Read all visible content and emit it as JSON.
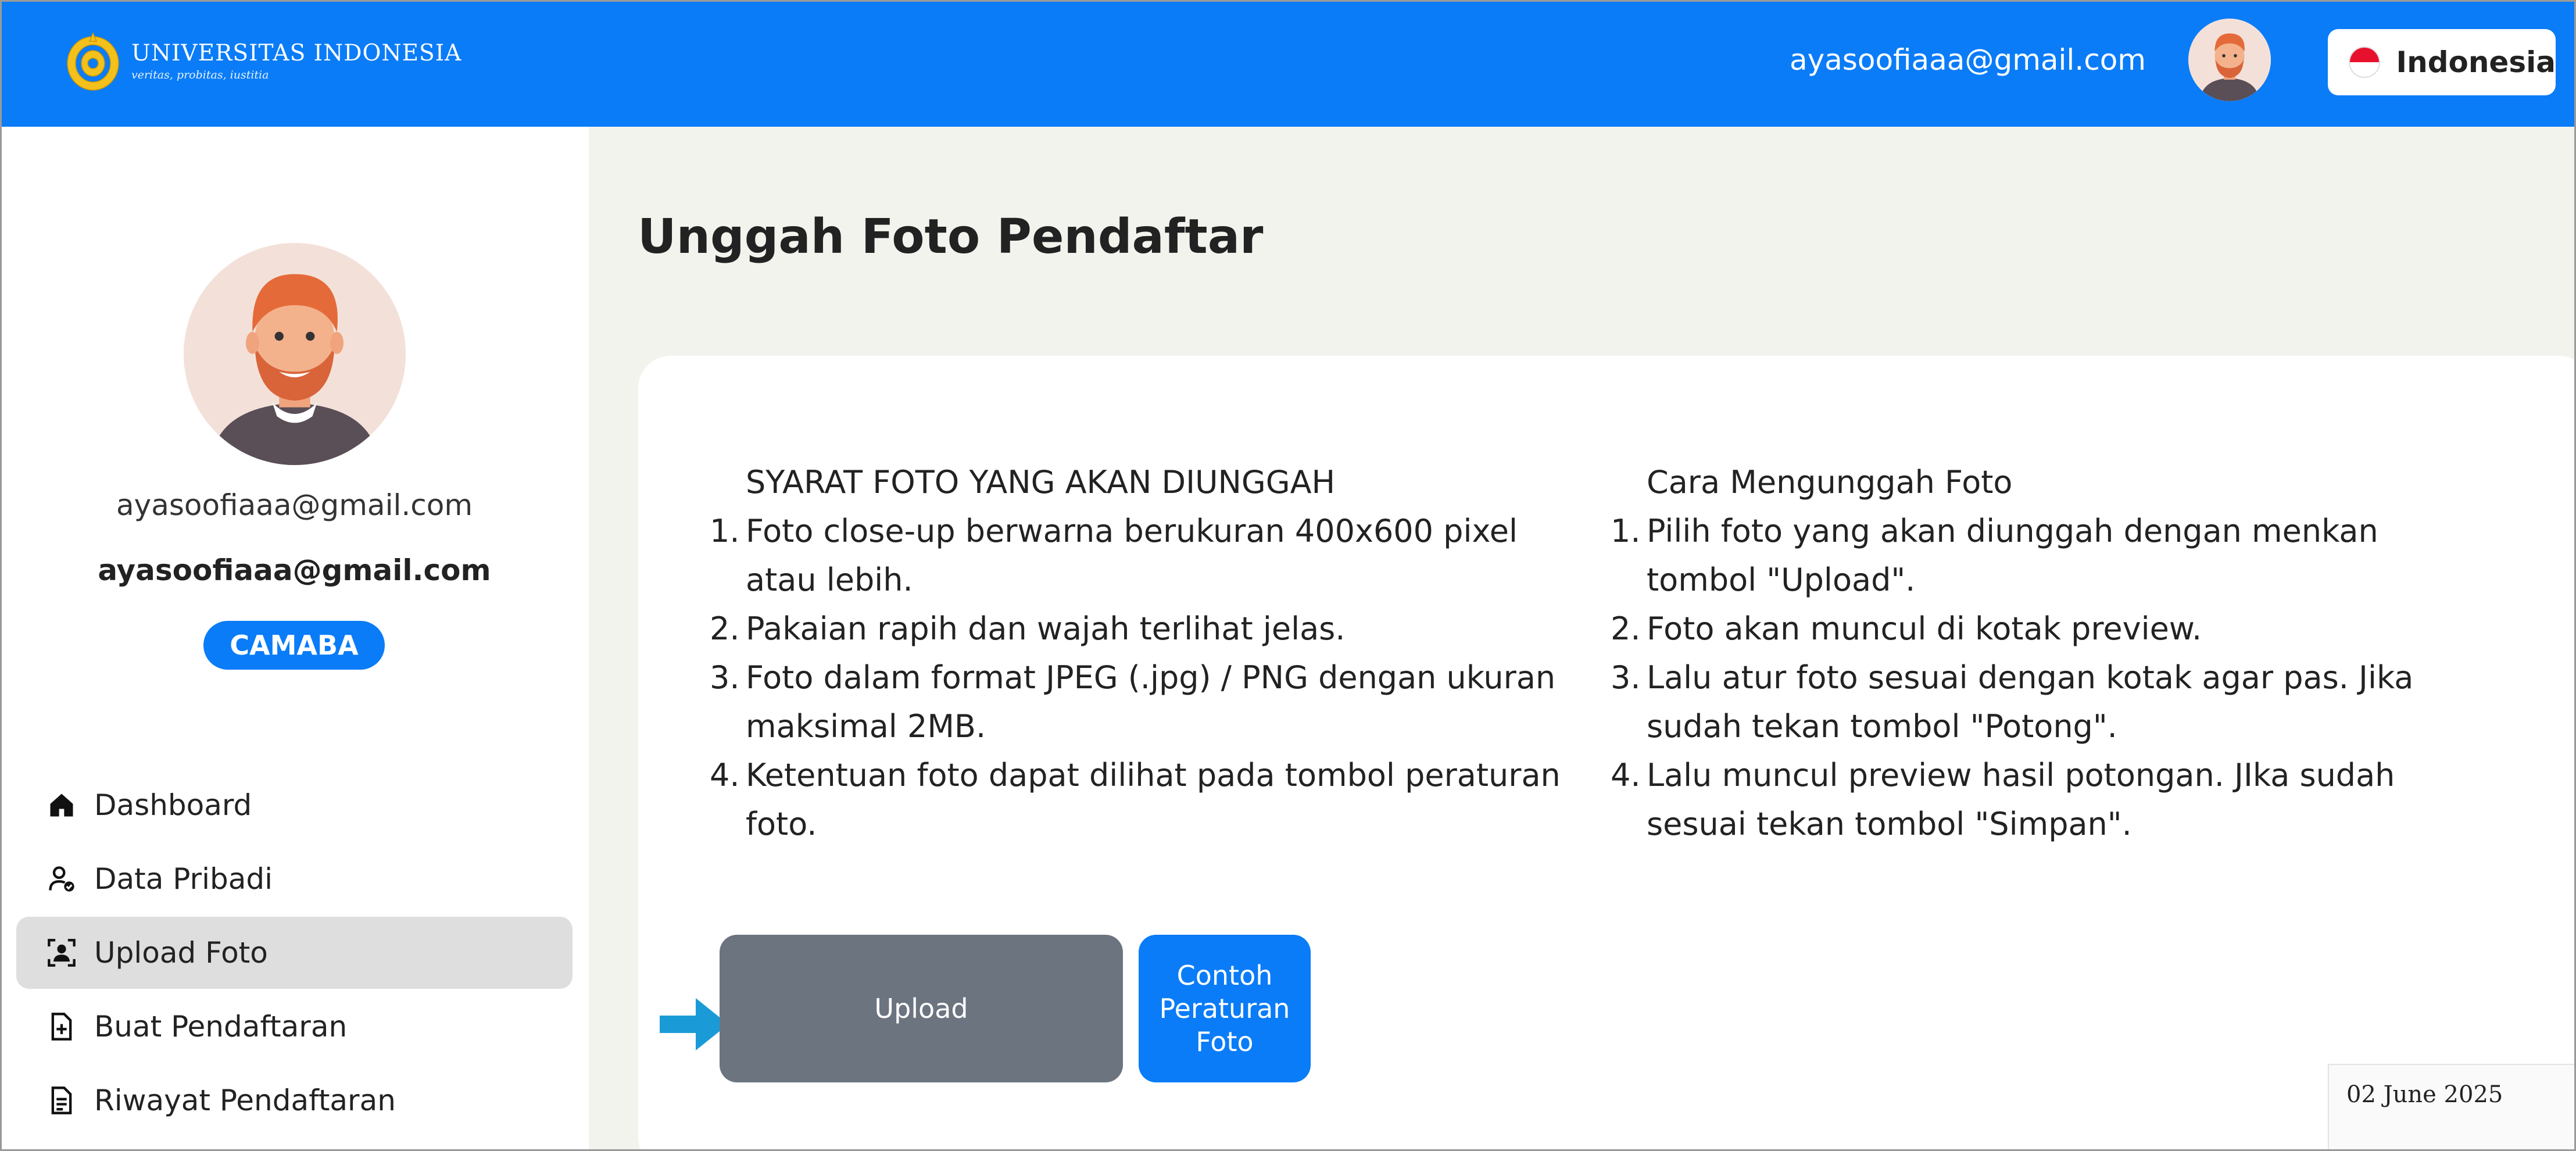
{
  "header": {
    "logo_title": "UNIVERSITAS INDONESIA",
    "logo_tagline": "veritas, probitas, iustitia",
    "user_email": "ayasoofiaaa@gmail.com",
    "language_label": "Indonesia",
    "brand_color": "#0a7cf8"
  },
  "sidebar": {
    "email": "ayasoofiaaa@gmail.com",
    "username": "ayasoofiaaa@gmail.com",
    "role": "CAMABA",
    "items": [
      {
        "label": "Dashboard",
        "icon": "home-icon",
        "active": false
      },
      {
        "label": "Data Pribadi",
        "icon": "user-check-icon",
        "active": false
      },
      {
        "label": "Upload Foto",
        "icon": "portrait-icon",
        "active": true
      },
      {
        "label": "Buat Pendaftaran",
        "icon": "file-plus-icon",
        "active": false
      },
      {
        "label": "Riwayat Pendaftaran",
        "icon": "file-text-icon",
        "active": false
      }
    ]
  },
  "main": {
    "title": "Unggah Foto Pendaftar",
    "requirements": {
      "heading": "SYARAT FOTO YANG AKAN DIUNGGAH",
      "items": [
        "Foto close-up berwarna berukuran 400x600 pixel atau lebih.",
        "Pakaian rapih dan wajah terlihat jelas.",
        "Foto dalam format JPEG (.jpg) / PNG dengan ukuran maksimal 2MB.",
        "Ketentuan foto dapat dilihat pada tombol peraturan foto."
      ]
    },
    "howto": {
      "heading": "Cara Mengunggah Foto",
      "items": [
        "Pilih foto yang akan diunggah dengan menkan tombol \"Upload\".",
        "Foto akan muncul di kotak preview.",
        "Lalu atur foto sesuai dengan kotak agar pas. Jika sudah tekan tombol \"Potong\".",
        "Lalu muncul preview hasil potongan. JIka sudah sesuai tekan tombol \"Simpan\"."
      ]
    },
    "upload_label": "Upload",
    "example_label": "Contoh Peraturan Foto"
  },
  "footer": {
    "date": "02 June 2025"
  }
}
